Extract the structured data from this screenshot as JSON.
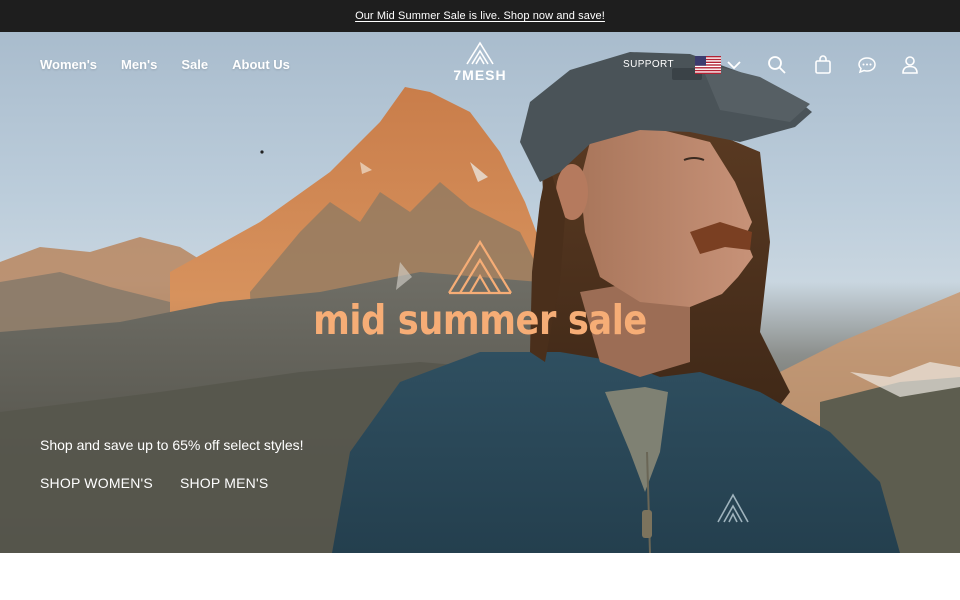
{
  "announcement": {
    "text": "Our Mid Summer Sale is live. Shop now and save!"
  },
  "header": {
    "nav": [
      {
        "label": "Women's"
      },
      {
        "label": "Men's"
      },
      {
        "label": "Sale"
      },
      {
        "label": "About Us"
      }
    ],
    "logo_text": "7MESH",
    "support_label": "SUPPORT",
    "icons": [
      "us-flag-icon",
      "chevron-down-icon",
      "search-icon",
      "bag-icon",
      "chat-icon",
      "account-icon"
    ]
  },
  "hero": {
    "title": "mid summer sale",
    "subtitle": "Shop and save up to 65% off select styles!",
    "ctas": [
      {
        "label": "SHOP WOMEN'S"
      },
      {
        "label": "SHOP MEN'S"
      }
    ]
  },
  "colors": {
    "announcement_bg": "#1e1e1e",
    "sale_title": "#f6ad76",
    "text_light": "#ffffff"
  }
}
